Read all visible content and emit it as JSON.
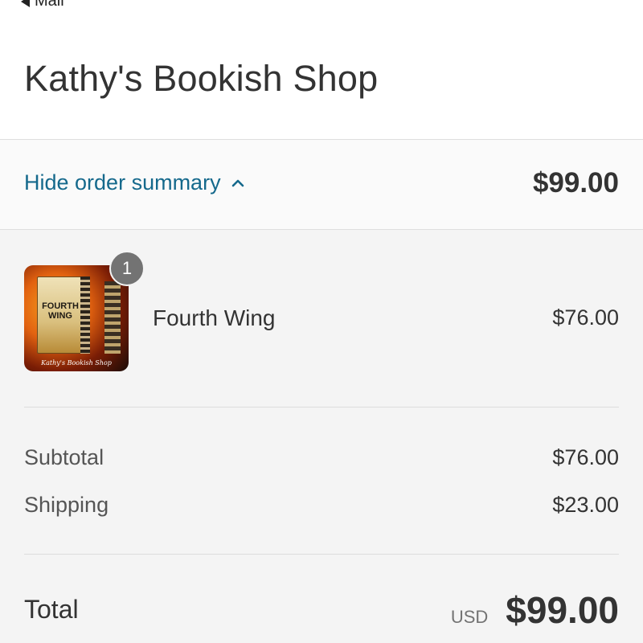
{
  "app": {
    "back_label": "Mail"
  },
  "header": {
    "shop_name": "Kathy's Bookish Shop"
  },
  "summary_bar": {
    "toggle_label": "Hide order summary",
    "total": "$99.00"
  },
  "line_items": [
    {
      "name": "Fourth Wing",
      "quantity": "1",
      "price": "$76.00",
      "thumbnail_title": "FOURTH WING",
      "thumbnail_signature": "Kathy's Bookish Shop"
    }
  ],
  "costs": {
    "subtotal_label": "Subtotal",
    "subtotal_value": "$76.00",
    "shipping_label": "Shipping",
    "shipping_value": "$23.00"
  },
  "total": {
    "label": "Total",
    "currency": "USD",
    "value": "$99.00"
  },
  "colors": {
    "link": "#15698c",
    "badge": "#737373",
    "summary_bg": "#f4f4f4"
  }
}
